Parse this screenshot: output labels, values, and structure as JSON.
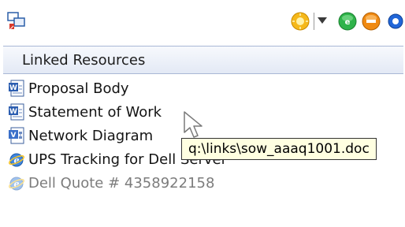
{
  "header": {
    "column_label": "Linked Resources"
  },
  "toolbar": {
    "left_icon": "linked-resources-icon",
    "buttons": [
      {
        "name": "sun-icon",
        "color": "#f5b81a"
      },
      {
        "name": "add-green-icon",
        "color": "#2fb34a"
      },
      {
        "name": "remove-orange-icon",
        "color": "#f08a13"
      },
      {
        "name": "add-blue-icon",
        "color": "#2166d8"
      }
    ]
  },
  "resources": [
    {
      "label": "Proposal Body",
      "icon": "word-document-icon",
      "dimmed": false
    },
    {
      "label": "Statement of Work",
      "icon": "word-document-icon",
      "dimmed": false
    },
    {
      "label": "Network Diagram",
      "icon": "visio-diagram-icon",
      "dimmed": false
    },
    {
      "label": "UPS Tracking for Dell Server",
      "icon": "internet-explorer-icon",
      "dimmed": false
    },
    {
      "label": "Dell Quote # 4358922158",
      "icon": "internet-explorer-icon",
      "dimmed": true
    }
  ],
  "tooltip": {
    "text": "q:\\links\\sow_aaaq1001.doc"
  }
}
